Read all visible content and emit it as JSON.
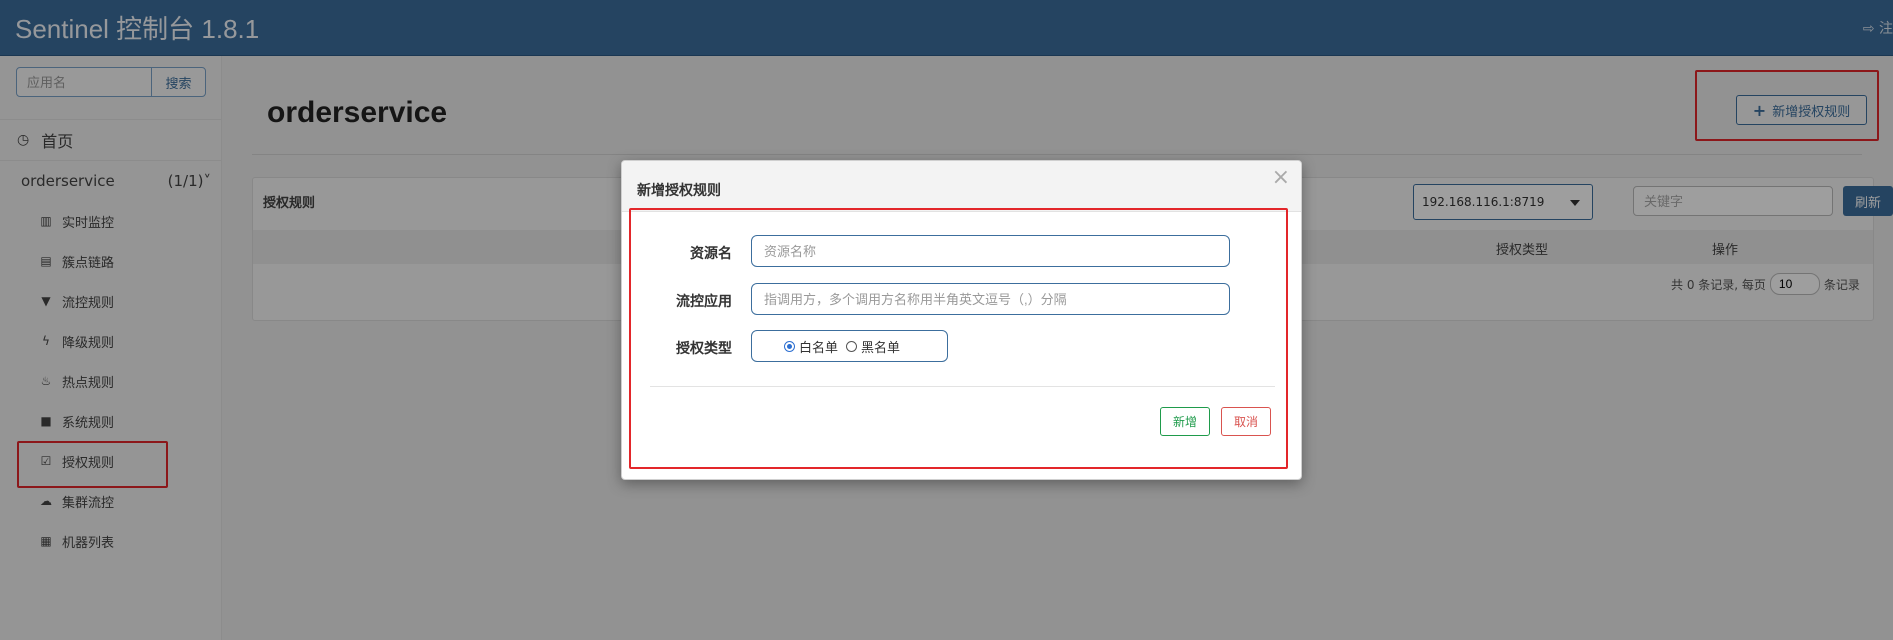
{
  "app": {
    "title": "Sentinel 控制台 1.8.1",
    "logout_label": "注"
  },
  "sidebar": {
    "search": {
      "placeholder": "应用名",
      "button_label": "搜索"
    },
    "home_label": "首页",
    "app_name": "orderservice",
    "app_count": "(1/1)",
    "items": [
      {
        "label": "实时监控",
        "icon": "bar-chart-icon",
        "glyph": "▥"
      },
      {
        "label": "簇点链路",
        "icon": "list-icon",
        "glyph": "▤"
      },
      {
        "label": "流控规则",
        "icon": "filter-icon",
        "glyph": "▼"
      },
      {
        "label": "降级规则",
        "icon": "flash-icon",
        "glyph": "ϟ"
      },
      {
        "label": "热点规则",
        "icon": "fire-icon",
        "glyph": "♨"
      },
      {
        "label": "系统规则",
        "icon": "lock-icon",
        "glyph": "■"
      },
      {
        "label": "授权规则",
        "icon": "check-icon",
        "glyph": "☑"
      },
      {
        "label": "集群流控",
        "icon": "cloud-icon",
        "glyph": "☁"
      },
      {
        "label": "机器列表",
        "icon": "th-list-icon",
        "glyph": "▦"
      }
    ]
  },
  "main": {
    "page_title": "orderservice",
    "add_button_label": "新增授权规则",
    "panel_title": "授权规则",
    "machine_select": "192.168.116.1:8719",
    "keyword_placeholder": "关键字",
    "refresh_label": "刷新",
    "columns": {
      "auth_type": "授权类型",
      "operation": "操作"
    },
    "pager": {
      "prefix": "共 0 条记录, 每页",
      "page_size": "10",
      "suffix": "条记录"
    }
  },
  "modal": {
    "title": "新增授权规则",
    "close_glyph": "×",
    "resource_label": "资源名",
    "resource_placeholder": "资源名称",
    "limit_app_label": "流控应用",
    "limit_app_placeholder": "指调用方，多个调用方名称用半角英文逗号（,）分隔",
    "strategy_label": "授权类型",
    "strategy_options": [
      "白名单",
      "黑名单"
    ],
    "strategy_selected": "白名单",
    "add_label": "新增",
    "cancel_label": "取消"
  },
  "colors": {
    "header": "#3c6e9d",
    "highlight": "#e3262a",
    "add_green": "#1f9b4b",
    "cancel_red": "#d9534f"
  }
}
